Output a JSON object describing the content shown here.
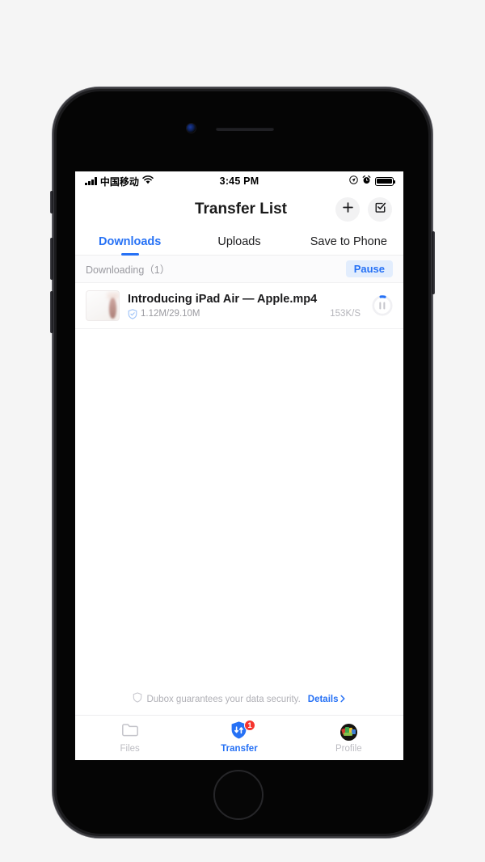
{
  "status_bar": {
    "carrier": "中国移动",
    "time": "3:45 PM",
    "signal_icon": "signal-bars-icon",
    "wifi_icon": "wifi-icon",
    "location_icon": "location-arrow-icon",
    "alarm_icon": "alarm-clock-icon",
    "battery_icon": "battery-full-icon"
  },
  "nav": {
    "title": "Transfer List",
    "add_icon": "plus-icon",
    "select_icon": "checkbox-check-icon"
  },
  "tabs": [
    {
      "label": "Downloads",
      "active": true
    },
    {
      "label": "Uploads",
      "active": false
    },
    {
      "label": "Save to Phone",
      "active": false
    }
  ],
  "section": {
    "title": "Downloading（1）",
    "pause_label": "Pause"
  },
  "downloads": [
    {
      "name": "Introducing iPad Air — Apple.mp4",
      "size": "1.12M/29.10M",
      "speed": "153K/S",
      "shield_icon": "shield-check-icon",
      "control_icon": "pause-icon",
      "progress_percent": 4
    }
  ],
  "security": {
    "shield_icon": "shield-icon",
    "text": "Dubox guarantees your data security.",
    "details_label": "Details",
    "chevron_icon": "chevron-right-icon"
  },
  "tabbar": [
    {
      "label": "Files",
      "icon": "folder-icon",
      "active": false,
      "badge": ""
    },
    {
      "label": "Transfer",
      "icon": "transfer-shield-icon",
      "active": true,
      "badge": "1"
    },
    {
      "label": "Profile",
      "icon": "avatar-icon",
      "active": false,
      "badge": ""
    }
  ],
  "colors": {
    "accent": "#2671f5",
    "badge": "#f5342e",
    "muted": "#9a9aa0",
    "pause_bg": "#e2edfd"
  }
}
